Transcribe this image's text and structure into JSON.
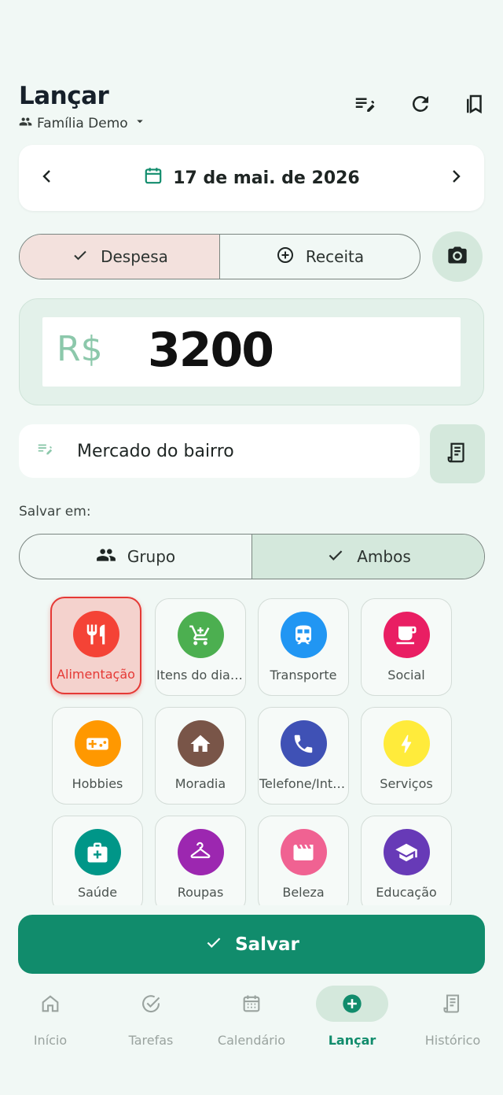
{
  "header": {
    "title": "Lançar",
    "family": "Família Demo"
  },
  "date": {
    "label": "17 de mai. de 2026"
  },
  "type_toggle": {
    "expense": "Despesa",
    "income": "Receita",
    "selected": "expense"
  },
  "amount": {
    "currency": "R$",
    "value": "3200"
  },
  "description": {
    "value": "Mercado do bairro"
  },
  "save_in": {
    "label": "Salvar em:",
    "group": "Grupo",
    "both": "Ambos",
    "selected": "both"
  },
  "categories": [
    {
      "label": "Alimentação",
      "color": "#f44336",
      "icon": "restaurant-icon",
      "selected": true
    },
    {
      "label": "Itens do dia a dia",
      "color": "#4caf50",
      "icon": "cart-icon"
    },
    {
      "label": "Transporte",
      "color": "#2196f3",
      "icon": "train-icon"
    },
    {
      "label": "Social",
      "color": "#e91e63",
      "icon": "cup-icon"
    },
    {
      "label": "Hobbies",
      "color": "#ff9800",
      "icon": "gamepad-icon"
    },
    {
      "label": "Moradia",
      "color": "#795548",
      "icon": "home-icon"
    },
    {
      "label": "Telefone/Internet",
      "color": "#3f51b5",
      "icon": "phone-icon"
    },
    {
      "label": "Serviços",
      "color": "#ffeb3b",
      "icon": "bolt-icon"
    },
    {
      "label": "Saúde",
      "color": "#009688",
      "icon": "medkit-icon"
    },
    {
      "label": "Roupas",
      "color": "#9c27b0",
      "icon": "hanger-icon"
    },
    {
      "label": "Beleza",
      "color": "#f06292",
      "icon": "clapper-icon"
    },
    {
      "label": "Educação",
      "color": "#673ab7",
      "icon": "school-icon"
    }
  ],
  "save_button": {
    "label": "Salvar"
  },
  "nav": {
    "items": [
      {
        "label": "Início",
        "icon": "home-icon"
      },
      {
        "label": "Tarefas",
        "icon": "check-circle-icon"
      },
      {
        "label": "Calendário",
        "icon": "calendar-icon"
      },
      {
        "label": "Lançar",
        "icon": "add-circle-icon",
        "active": true
      },
      {
        "label": "Histórico",
        "icon": "receipt-icon"
      }
    ]
  },
  "colors": {
    "accent": "#118c6c",
    "expense_selected": "#f3e1dd",
    "soft_green": "#d4e8dc",
    "background": "#f1f8f5"
  }
}
